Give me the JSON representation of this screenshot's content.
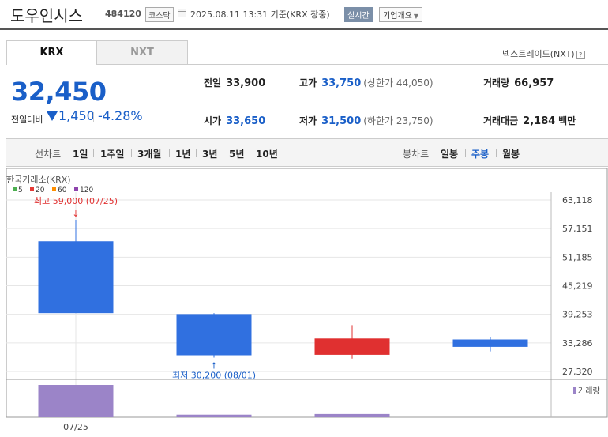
{
  "header": {
    "name": "도우인시스",
    "code": "484120",
    "market": "코스닥",
    "datetime": "2025.08.11 13:31  기준(KRX 장중)",
    "realtime": "실시간",
    "company_btn": "기업개요"
  },
  "tabs": [
    "KRX",
    "NXT"
  ],
  "nxt_link": "넥스트레이드(NXT)",
  "nxt_help": "?",
  "quote": {
    "price": "32,450",
    "change_label": "전일대비",
    "change_value": "1,450",
    "change_pct": "-4.28%"
  },
  "stats": {
    "prev_label": "전일",
    "prev": "33,900",
    "high_label": "고가",
    "high": "33,750",
    "upper_label": "(상한가",
    "upper": "44,050)",
    "volume_label": "거래량",
    "volume": "66,957",
    "open_label": "시가",
    "open": "33,650",
    "low_label": "저가",
    "low": "31,500",
    "lower_label": "(하한가",
    "lower": "23,750)",
    "amount_label": "거래대금",
    "amount": "2,184",
    "amount_unit": "백만"
  },
  "periods": {
    "line_label": "선차트",
    "line": [
      "1일",
      "1주일",
      "3개월",
      "1년",
      "3년",
      "5년",
      "10년"
    ],
    "candle_label": "봉차트",
    "candle": [
      "일봉",
      "주봉",
      "월봉"
    ],
    "candle_active": "주봉"
  },
  "chart_data": {
    "type": "candlestick",
    "exchange_label": "한국거래소(KRX)",
    "legend": [
      {
        "name": "5",
        "color": "#4caf50"
      },
      {
        "name": "20",
        "color": "#e53935"
      },
      {
        "name": "60",
        "color": "#ff8f00"
      },
      {
        "name": "120",
        "color": "#8e44ad"
      }
    ],
    "y_ticks": [
      "63,118",
      "57,151",
      "51,185",
      "45,219",
      "39,253",
      "33,286",
      "27,320"
    ],
    "ylim": [
      27320,
      63118
    ],
    "candles": [
      {
        "open": 54500,
        "high": 59000,
        "low": 39500,
        "close": 39500,
        "color": "#3070e0"
      },
      {
        "open": 39300,
        "high": 39500,
        "low": 30200,
        "close": 30700,
        "color": "#3070e0"
      },
      {
        "open": 30800,
        "high": 37000,
        "low": 30000,
        "close": 34200,
        "color": "#e03030"
      },
      {
        "open": 34000,
        "high": 34500,
        "low": 31500,
        "close": 32450,
        "color": "#3070e0"
      }
    ],
    "volume_label": "거래량",
    "volumes": [
      1.0,
      0.08,
      0.1,
      0.0
    ],
    "volume_color": "#9b84c8",
    "high_annot": "최고 59,000 (07/25)",
    "low_annot": "최저 30,200 (08/01)",
    "x_labels": [
      "07/25"
    ]
  }
}
